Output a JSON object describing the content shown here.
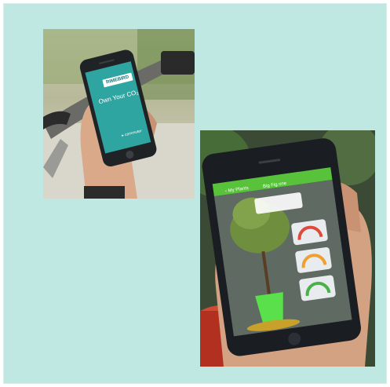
{
  "photo_left": {
    "screen_brand": "RIMEBIRD",
    "screen_headline": "Own Your CO₂",
    "screen_footer": "▸ commuter"
  },
  "photo_right": {
    "nav_back": "‹ My Plants",
    "nav_title": "Big Fig one"
  },
  "colors": {
    "background": "#bfe8e2",
    "app_teal": "#2fa5a2",
    "app_green": "#58c23a"
  }
}
